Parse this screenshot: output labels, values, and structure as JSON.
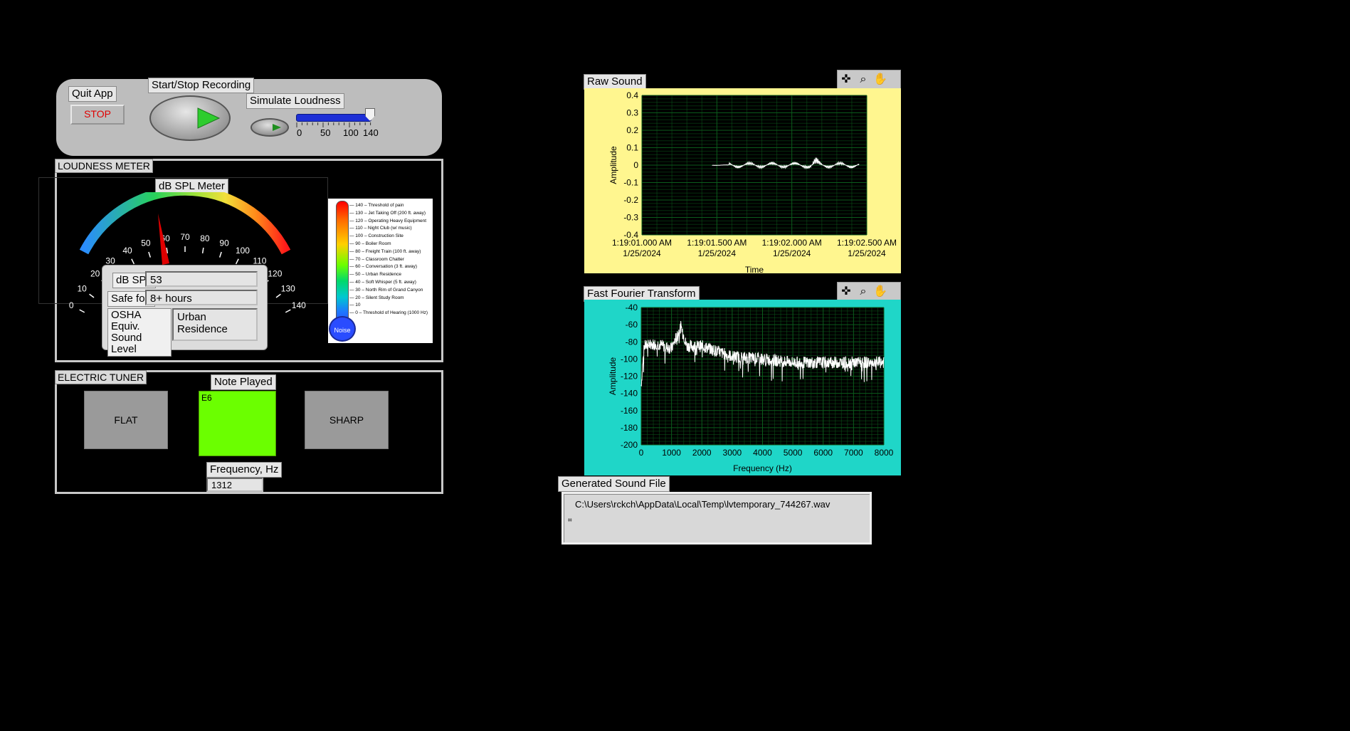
{
  "controls": {
    "quit_label": "Quit App",
    "stop_button": "STOP",
    "record_label": "Start/Stop Recording",
    "simulate_label": "Simulate Loudness",
    "slider_value": 140,
    "slider_ticks": [
      "0",
      "50",
      "100",
      "140"
    ]
  },
  "loudness": {
    "panel_title": "LOUDNESS METER",
    "meter_title": "dB SPL Meter",
    "gauge_ticks": [
      "0",
      "10",
      "20",
      "30",
      "40",
      "50",
      "60",
      "70",
      "80",
      "90",
      "100",
      "110",
      "120",
      "130",
      "140"
    ],
    "gauge_value": 53,
    "spl_label": "dB SPL",
    "spl_value": "53",
    "safe_label": "Safe for:",
    "safe_value": "8+ hours",
    "osha_label": "OSHA Equiv. Sound Level",
    "osha_value": "Urban Residence",
    "thermo_bulb": "Noise",
    "thermo_scale": [
      "140 – Threshold of pain",
      "130 – Jet Taking Off (200 ft. away)",
      "120 – Operating Heavy Equipment",
      "110 – Night Club (w/ music)",
      "100 – Construction Site",
      "90 – Boiler Room",
      "80 – Freight Train (100 ft. away)",
      "70 – Classroom Chatter",
      "60 – Conversation (3 ft. away)",
      "50 – Urban Residence",
      "40 – Soft Whisper (5 ft. away)",
      "30 – North Rim of Grand Canyon",
      "20 – Silent Study Room",
      "10",
      "0 – Threshold of Hearing (1000 Hz)"
    ]
  },
  "tuner": {
    "panel_title": "ELECTRIC TUNER",
    "flat": "FLAT",
    "sharp": "SHARP",
    "note_label": "Note Played",
    "note_value": "E6",
    "freq_label": "Frequency, Hz",
    "freq_value": "1312",
    "note_color": "#6bff00"
  },
  "raw_sound": {
    "title": "Raw Sound",
    "ylabel": "Amplitude",
    "xlabel": "Time",
    "y_ticks": [
      "0.4",
      "0.3",
      "0.2",
      "0.1",
      "0",
      "-0.1",
      "-0.2",
      "-0.3",
      "-0.4"
    ],
    "x_ticks": [
      [
        "1:19:01.000 AM",
        "1/25/2024"
      ],
      [
        "1:19:01.500 AM",
        "1/25/2024"
      ],
      [
        "1:19:02.000 AM",
        "1/25/2024"
      ],
      [
        "1:19:02.500 AM",
        "1/25/2024"
      ]
    ],
    "bg_color": "#fff68f"
  },
  "fft": {
    "title": "Fast Fourier Transform",
    "ylabel": "Amplitude",
    "xlabel": "Frequency (Hz)",
    "y_ticks": [
      "-40",
      "-60",
      "-80",
      "-100",
      "-120",
      "-140",
      "-160",
      "-180",
      "-200"
    ],
    "x_ticks": [
      "0",
      "1000",
      "2000",
      "3000",
      "4000",
      "5000",
      "6000",
      "7000",
      "8000"
    ],
    "bg_color": "#1fd6c8"
  },
  "sound_file": {
    "label": "Generated Sound File",
    "path": "C:\\Users\\rckch\\AppData\\Local\\Temp\\lvtemporary_744267.wav"
  },
  "chart_data": [
    {
      "type": "line",
      "title": "Raw Sound",
      "xlabel": "Time",
      "ylabel": "Amplitude",
      "x_ticks": [
        "1:19:01.000 AM 1/25/2024",
        "1:19:01.500 AM 1/25/2024",
        "1:19:02.000 AM 1/25/2024",
        "1:19:02.500 AM 1/25/2024"
      ],
      "ylim": [
        -0.4,
        0.4
      ],
      "grid": true,
      "description_series": [
        {
          "x_seconds_from_1_19_01": [
            0.47,
            0.58,
            1.12,
            1.16,
            1.22,
            1.45
          ],
          "amplitude_envelope": [
            0.0,
            0.02,
            0.02,
            0.05,
            0.02,
            0.02
          ]
        }
      ]
    },
    {
      "type": "line",
      "title": "Fast Fourier Transform",
      "xlabel": "Frequency (Hz)",
      "ylabel": "Amplitude",
      "xlim": [
        0,
        8000
      ],
      "ylim": [
        -200,
        -40
      ],
      "grid": true,
      "x": [
        0,
        100,
        500,
        1000,
        1312,
        1500,
        2000,
        3000,
        4000,
        5000,
        6000,
        7000,
        8000
      ],
      "y": [
        -130,
        -85,
        -82,
        -88,
        -62,
        -85,
        -85,
        -97,
        -100,
        -104,
        -104,
        -104,
        -104
      ]
    }
  ]
}
